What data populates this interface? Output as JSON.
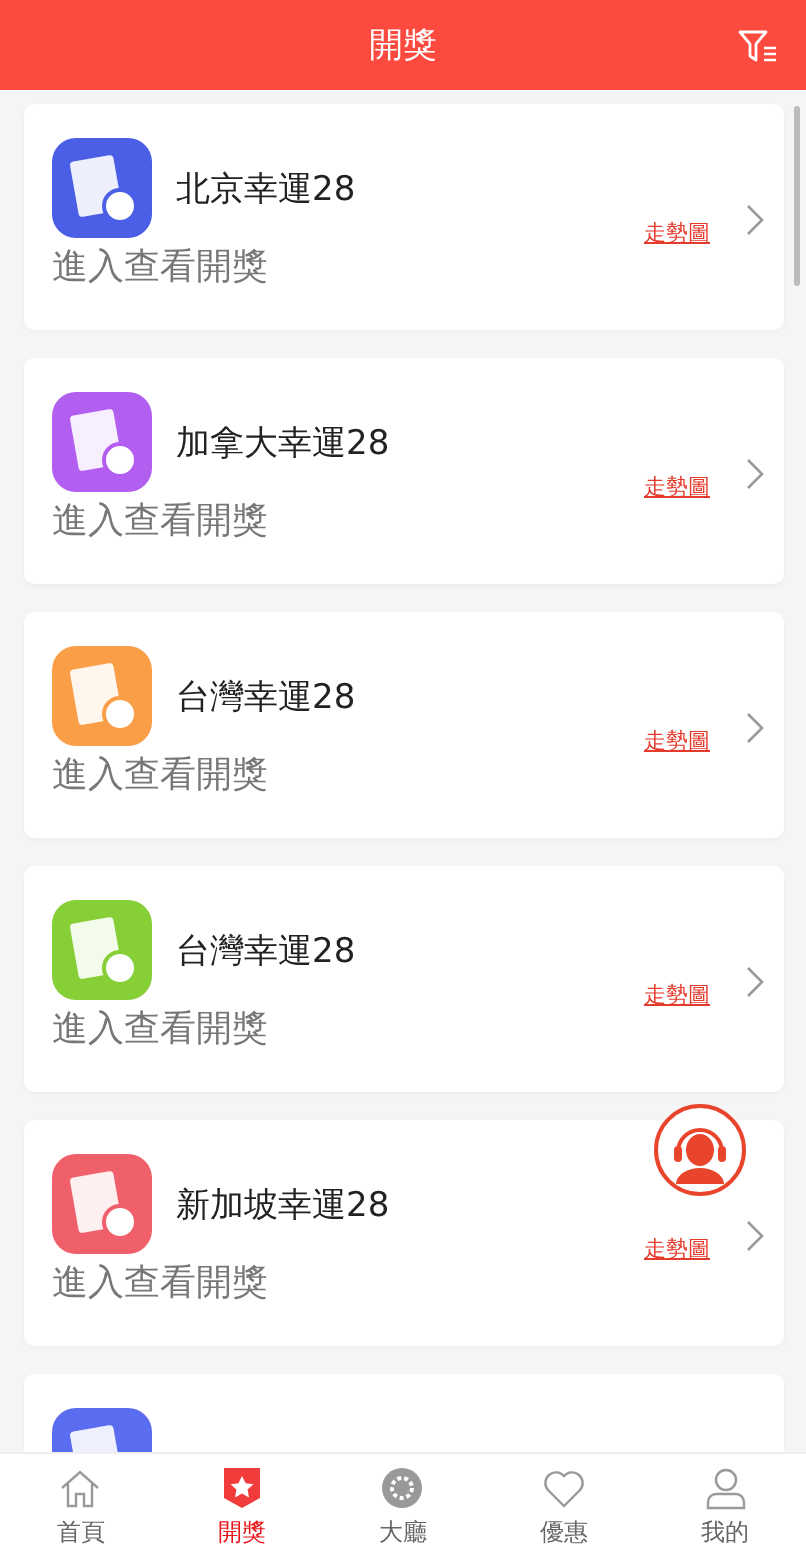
{
  "header": {
    "title": "開獎"
  },
  "lotteries": [
    {
      "name": "北京幸運28",
      "subtitle": "進入查看開獎",
      "trend_link": "走勢圖",
      "color": "#4a5ee6"
    },
    {
      "name": "加拿大幸運28",
      "subtitle": "進入查看開獎",
      "trend_link": "走勢圖",
      "color": "#b25ef0"
    },
    {
      "name": "台灣幸運28",
      "subtitle": "進入查看開獎",
      "trend_link": "走勢圖",
      "color": "#fb9e48"
    },
    {
      "name": "台灣幸運28",
      "subtitle": "進入查看開獎",
      "trend_link": "走勢圖",
      "color": "#86cf37"
    },
    {
      "name": "新加坡幸運28",
      "subtitle": "進入查看開獎",
      "trend_link": "走勢圖",
      "color": "#f0606a"
    },
    {
      "color": "#5a6cf0"
    }
  ],
  "nav": [
    {
      "kind": "home",
      "label": "首頁",
      "selected": false
    },
    {
      "kind": "draw",
      "label": "開獎",
      "selected": true
    },
    {
      "kind": "lobby",
      "label": "大廳",
      "selected": false
    },
    {
      "kind": "promo",
      "label": "優惠",
      "selected": false
    },
    {
      "kind": "me",
      "label": "我的",
      "selected": false
    }
  ]
}
